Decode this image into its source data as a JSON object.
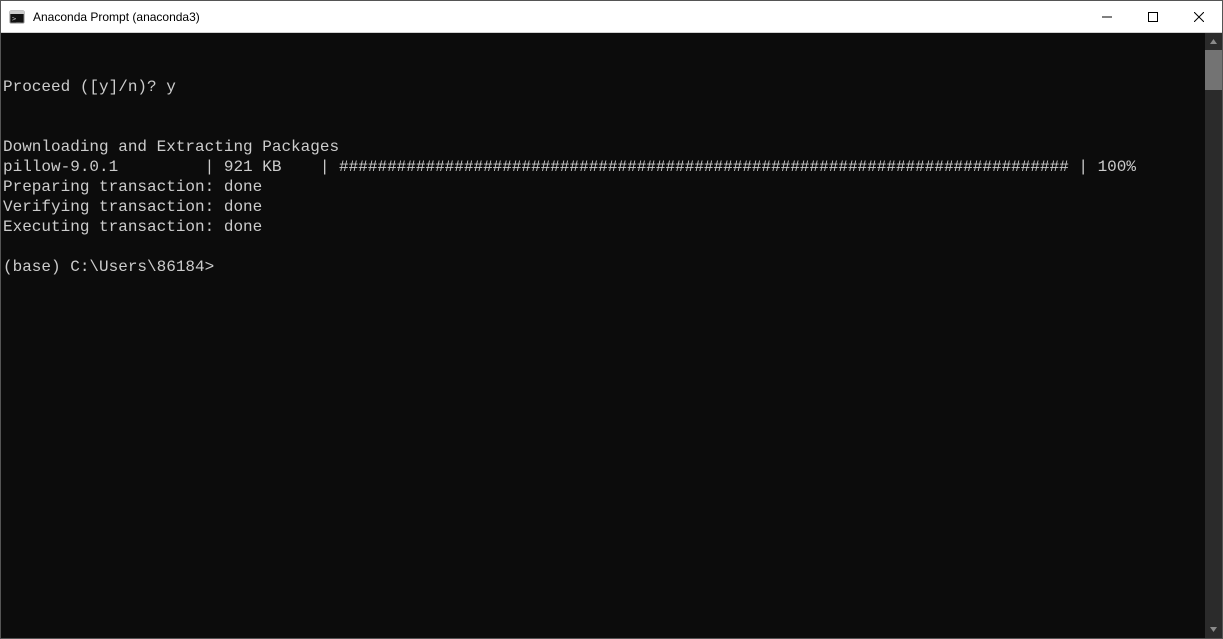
{
  "window": {
    "title": "Anaconda Prompt (anaconda3)"
  },
  "terminal": {
    "lines": [
      "",
      "",
      "Proceed ([y]/n)? y",
      "",
      "",
      "Downloading and Extracting Packages",
      "pillow-9.0.1         | 921 KB    | ############################################################################ | 100%",
      "Preparing transaction: done",
      "Verifying transaction: done",
      "Executing transaction: done",
      "",
      "(base) C:\\Users\\86184>"
    ]
  }
}
